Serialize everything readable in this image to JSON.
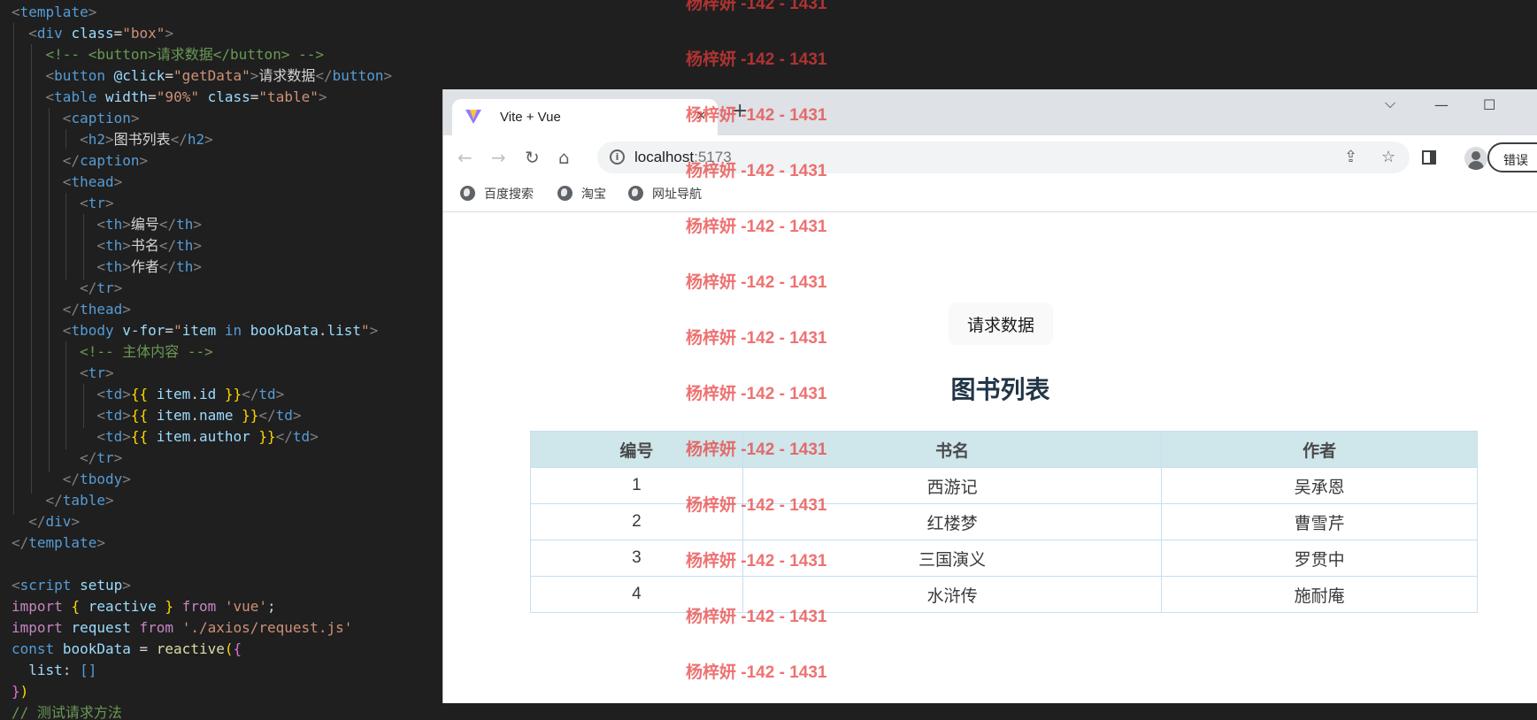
{
  "editor": {
    "lines": [
      [
        [
          "t-tag",
          "<"
        ],
        [
          "t-name",
          "template"
        ],
        [
          "t-tag",
          ">"
        ]
      ],
      [
        [
          "t-text",
          "  "
        ],
        [
          "t-tag",
          "<"
        ],
        [
          "t-name",
          "div"
        ],
        [
          "t-text",
          " "
        ],
        [
          "t-attr",
          "class"
        ],
        [
          "t-op",
          "="
        ],
        [
          "t-str",
          "\"box\""
        ],
        [
          "t-tag",
          ">"
        ]
      ],
      [
        [
          "t-text",
          "    "
        ],
        [
          "t-com",
          "<!-- <button>请求数据</button> -->"
        ]
      ],
      [
        [
          "t-text",
          "    "
        ],
        [
          "t-tag",
          "<"
        ],
        [
          "t-name",
          "button"
        ],
        [
          "t-text",
          " "
        ],
        [
          "t-attr",
          "@click"
        ],
        [
          "t-op",
          "="
        ],
        [
          "t-str",
          "\"getData\""
        ],
        [
          "t-tag",
          ">"
        ],
        [
          "t-text",
          "请求数据"
        ],
        [
          "t-tag",
          "</"
        ],
        [
          "t-name",
          "button"
        ],
        [
          "t-tag",
          ">"
        ]
      ],
      [
        [
          "t-text",
          "    "
        ],
        [
          "t-tag",
          "<"
        ],
        [
          "t-name",
          "table"
        ],
        [
          "t-text",
          " "
        ],
        [
          "t-attr",
          "width"
        ],
        [
          "t-op",
          "="
        ],
        [
          "t-str",
          "\"90%\""
        ],
        [
          "t-text",
          " "
        ],
        [
          "t-attr",
          "class"
        ],
        [
          "t-op",
          "="
        ],
        [
          "t-str",
          "\"table\""
        ],
        [
          "t-tag",
          ">"
        ]
      ],
      [
        [
          "t-text",
          "      "
        ],
        [
          "t-tag",
          "<"
        ],
        [
          "t-name",
          "caption"
        ],
        [
          "t-tag",
          ">"
        ]
      ],
      [
        [
          "t-text",
          "        "
        ],
        [
          "t-tag",
          "<"
        ],
        [
          "t-name",
          "h2"
        ],
        [
          "t-tag",
          ">"
        ],
        [
          "t-text",
          "图书列表"
        ],
        [
          "t-tag",
          "</"
        ],
        [
          "t-name",
          "h2"
        ],
        [
          "t-tag",
          ">"
        ]
      ],
      [
        [
          "t-text",
          "      "
        ],
        [
          "t-tag",
          "</"
        ],
        [
          "t-name",
          "caption"
        ],
        [
          "t-tag",
          ">"
        ]
      ],
      [
        [
          "t-text",
          "      "
        ],
        [
          "t-tag",
          "<"
        ],
        [
          "t-name",
          "thead"
        ],
        [
          "t-tag",
          ">"
        ]
      ],
      [
        [
          "t-text",
          "        "
        ],
        [
          "t-tag",
          "<"
        ],
        [
          "t-name",
          "tr"
        ],
        [
          "t-tag",
          ">"
        ]
      ],
      [
        [
          "t-text",
          "          "
        ],
        [
          "t-tag",
          "<"
        ],
        [
          "t-name",
          "th"
        ],
        [
          "t-tag",
          ">"
        ],
        [
          "t-text",
          "编号"
        ],
        [
          "t-tag",
          "</"
        ],
        [
          "t-name",
          "th"
        ],
        [
          "t-tag",
          ">"
        ]
      ],
      [
        [
          "t-text",
          "          "
        ],
        [
          "t-tag",
          "<"
        ],
        [
          "t-name",
          "th"
        ],
        [
          "t-tag",
          ">"
        ],
        [
          "t-text",
          "书名"
        ],
        [
          "t-tag",
          "</"
        ],
        [
          "t-name",
          "th"
        ],
        [
          "t-tag",
          ">"
        ]
      ],
      [
        [
          "t-text",
          "          "
        ],
        [
          "t-tag",
          "<"
        ],
        [
          "t-name",
          "th"
        ],
        [
          "t-tag",
          ">"
        ],
        [
          "t-text",
          "作者"
        ],
        [
          "t-tag",
          "</"
        ],
        [
          "t-name",
          "th"
        ],
        [
          "t-tag",
          ">"
        ]
      ],
      [
        [
          "t-text",
          "        "
        ],
        [
          "t-tag",
          "</"
        ],
        [
          "t-name",
          "tr"
        ],
        [
          "t-tag",
          ">"
        ]
      ],
      [
        [
          "t-text",
          "      "
        ],
        [
          "t-tag",
          "</"
        ],
        [
          "t-name",
          "thead"
        ],
        [
          "t-tag",
          ">"
        ]
      ],
      [
        [
          "t-text",
          "      "
        ],
        [
          "t-tag",
          "<"
        ],
        [
          "t-name",
          "tbody"
        ],
        [
          "t-text",
          " "
        ],
        [
          "t-attr",
          "v-for"
        ],
        [
          "t-op",
          "="
        ],
        [
          "t-str",
          "\""
        ],
        [
          "t-var",
          "item"
        ],
        [
          "t-text",
          " "
        ],
        [
          "t-kw2",
          "in"
        ],
        [
          "t-text",
          " "
        ],
        [
          "t-var",
          "bookData"
        ],
        [
          "t-text",
          "."
        ],
        [
          "t-var",
          "list"
        ],
        [
          "t-str",
          "\""
        ],
        [
          "t-tag",
          ">"
        ]
      ],
      [
        [
          "t-text",
          "        "
        ],
        [
          "t-com",
          "<!-- 主体内容 -->"
        ]
      ],
      [
        [
          "t-text",
          "        "
        ],
        [
          "t-tag",
          "<"
        ],
        [
          "t-name",
          "tr"
        ],
        [
          "t-tag",
          ">"
        ]
      ],
      [
        [
          "t-text",
          "          "
        ],
        [
          "t-tag",
          "<"
        ],
        [
          "t-name",
          "td"
        ],
        [
          "t-tag",
          ">"
        ],
        [
          "t-brace",
          "{{"
        ],
        [
          "t-text",
          " "
        ],
        [
          "t-var",
          "item"
        ],
        [
          "t-text",
          "."
        ],
        [
          "t-var",
          "id"
        ],
        [
          "t-text",
          " "
        ],
        [
          "t-brace",
          "}}"
        ],
        [
          "t-tag",
          "</"
        ],
        [
          "t-name",
          "td"
        ],
        [
          "t-tag",
          ">"
        ]
      ],
      [
        [
          "t-text",
          "          "
        ],
        [
          "t-tag",
          "<"
        ],
        [
          "t-name",
          "td"
        ],
        [
          "t-tag",
          ">"
        ],
        [
          "t-brace",
          "{{"
        ],
        [
          "t-text",
          " "
        ],
        [
          "t-var",
          "item"
        ],
        [
          "t-text",
          "."
        ],
        [
          "t-var",
          "name"
        ],
        [
          "t-text",
          " "
        ],
        [
          "t-brace",
          "}}"
        ],
        [
          "t-tag",
          "</"
        ],
        [
          "t-name",
          "td"
        ],
        [
          "t-tag",
          ">"
        ]
      ],
      [
        [
          "t-text",
          "          "
        ],
        [
          "t-tag",
          "<"
        ],
        [
          "t-name",
          "td"
        ],
        [
          "t-tag",
          ">"
        ],
        [
          "t-brace",
          "{{"
        ],
        [
          "t-text",
          " "
        ],
        [
          "t-var",
          "item"
        ],
        [
          "t-text",
          "."
        ],
        [
          "t-var",
          "author"
        ],
        [
          "t-text",
          " "
        ],
        [
          "t-brace",
          "}}"
        ],
        [
          "t-tag",
          "</"
        ],
        [
          "t-name",
          "td"
        ],
        [
          "t-tag",
          ">"
        ]
      ],
      [
        [
          "t-text",
          "        "
        ],
        [
          "t-tag",
          "</"
        ],
        [
          "t-name",
          "tr"
        ],
        [
          "t-tag",
          ">"
        ]
      ],
      [
        [
          "t-text",
          "      "
        ],
        [
          "t-tag",
          "</"
        ],
        [
          "t-name",
          "tbody"
        ],
        [
          "t-tag",
          ">"
        ]
      ],
      [
        [
          "t-text",
          "    "
        ],
        [
          "t-tag",
          "</"
        ],
        [
          "t-name",
          "table"
        ],
        [
          "t-tag",
          ">"
        ]
      ],
      [
        [
          "t-text",
          "  "
        ],
        [
          "t-tag",
          "</"
        ],
        [
          "t-name",
          "div"
        ],
        [
          "t-tag",
          ">"
        ]
      ],
      [
        [
          "t-tag",
          "</"
        ],
        [
          "t-name",
          "template"
        ],
        [
          "t-tag",
          ">"
        ]
      ],
      [
        [
          "t-text",
          ""
        ]
      ],
      [
        [
          "t-tag",
          "<"
        ],
        [
          "t-name",
          "script"
        ],
        [
          "t-text",
          " "
        ],
        [
          "t-attr",
          "setup"
        ],
        [
          "t-tag",
          ">"
        ]
      ],
      [
        [
          "t-kw",
          "import"
        ],
        [
          "t-text",
          " "
        ],
        [
          "t-brace",
          "{"
        ],
        [
          "t-text",
          " "
        ],
        [
          "t-var",
          "reactive"
        ],
        [
          "t-text",
          " "
        ],
        [
          "t-brace",
          "}"
        ],
        [
          "t-text",
          " "
        ],
        [
          "t-kw",
          "from"
        ],
        [
          "t-text",
          " "
        ],
        [
          "t-str",
          "'vue'"
        ],
        [
          "t-text",
          ";"
        ]
      ],
      [
        [
          "t-kw",
          "import"
        ],
        [
          "t-text",
          " "
        ],
        [
          "t-var",
          "request"
        ],
        [
          "t-text",
          " "
        ],
        [
          "t-kw",
          "from"
        ],
        [
          "t-text",
          " "
        ],
        [
          "t-str",
          "'./axios/request.js'"
        ]
      ],
      [
        [
          "t-kw2",
          "const"
        ],
        [
          "t-text",
          " "
        ],
        [
          "t-var",
          "bookData"
        ],
        [
          "t-text",
          " = "
        ],
        [
          "t-fn",
          "reactive"
        ],
        [
          "t-brace",
          "("
        ],
        [
          "t-pink",
          "{"
        ]
      ],
      [
        [
          "t-text",
          "  "
        ],
        [
          "t-var",
          "list"
        ],
        [
          "t-text",
          ": "
        ],
        [
          "t-kw2",
          "[]"
        ]
      ],
      [
        [
          "t-pink",
          "}"
        ],
        [
          "t-brace",
          ")"
        ]
      ],
      [
        [
          "t-com",
          "// 测试请求方法"
        ]
      ]
    ]
  },
  "browser": {
    "tab_title": "Vite + Vue",
    "tab_close": "×",
    "new_tab": "+",
    "url_host": "localhost",
    "url_port": ":5173",
    "error_label": "错误",
    "bookmarks": [
      "百度搜索",
      "淘宝",
      "网址导航"
    ]
  },
  "page": {
    "button_label": "请求数据",
    "caption": "图书列表",
    "headers": [
      "编号",
      "书名",
      "作者"
    ],
    "rows": [
      [
        "1",
        "西游记",
        "吴承恩"
      ],
      [
        "2",
        "红楼梦",
        "曹雪芹"
      ],
      [
        "3",
        "三国演义",
        "罗贯中"
      ],
      [
        "4",
        "水浒传",
        "施耐庵"
      ]
    ]
  },
  "watermark": {
    "text": "杨梓妍 -142 - 1431",
    "color": "#e83c3c"
  }
}
